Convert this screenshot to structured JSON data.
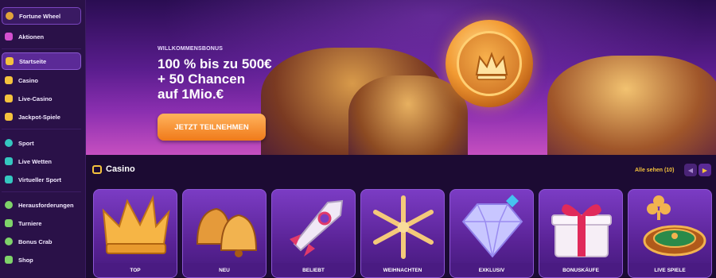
{
  "sidebar": {
    "items": [
      {
        "label": "Fortune Wheel",
        "icon": "fortune-wheel-icon",
        "color": "#e0a23a"
      },
      {
        "label": "Aktionen",
        "icon": "gift-icon",
        "color": "#d44fd0"
      },
      {
        "label": "Startseite",
        "icon": "home-icon",
        "color": "#f4c23d"
      },
      {
        "label": "Casino",
        "icon": "slot-icon",
        "color": "#f4c23d"
      },
      {
        "label": "Live-Casino",
        "icon": "live-casino-icon",
        "color": "#f4c23d"
      },
      {
        "label": "Jackpot-Spiele",
        "icon": "jackpot-icon",
        "color": "#f4c23d"
      },
      {
        "label": "Sport",
        "icon": "sport-icon",
        "color": "#35c7c0"
      },
      {
        "label": "Live Wetten",
        "icon": "live-bet-icon",
        "color": "#35c7c0"
      },
      {
        "label": "Virtueller Sport",
        "icon": "virtual-sport-icon",
        "color": "#35c7c0"
      },
      {
        "label": "Herausforderungen",
        "icon": "challenge-icon",
        "color": "#7fd36a"
      },
      {
        "label": "Turniere",
        "icon": "trophy-icon",
        "color": "#7fd36a"
      },
      {
        "label": "Bonus Crab",
        "icon": "crab-icon",
        "color": "#7fd36a"
      },
      {
        "label": "Shop",
        "icon": "shop-icon",
        "color": "#7fd36a"
      }
    ]
  },
  "hero": {
    "eyebrow": "WILLKOMMENSBONUS",
    "line1": "100 % bis zu 500€",
    "line2": "+ 50 Chancen",
    "line3": "auf 1Mio.€",
    "cta": "JETZT TEILNEHMEN"
  },
  "casino": {
    "title": "Casino",
    "see_all": "Alle sehen (10)",
    "prev": "◀",
    "next": "▶",
    "cards": [
      {
        "label": "TOP",
        "icon": "crown-icon"
      },
      {
        "label": "NEU",
        "icon": "bell-icon"
      },
      {
        "label": "BELIEBT",
        "icon": "rocket-icon"
      },
      {
        "label": "WEIHNACHTEN",
        "icon": "snowflake-icon"
      },
      {
        "label": "EXKLUSIV",
        "icon": "diamond-icon"
      },
      {
        "label": "BONUSKÄUFE",
        "icon": "gift-box-icon"
      },
      {
        "label": "LIVE SPIELE",
        "icon": "roulette-icon"
      }
    ]
  },
  "colors": {
    "accent": "#f4c23d",
    "cta": "#f07a1a",
    "sidebar": "#2a1148"
  }
}
